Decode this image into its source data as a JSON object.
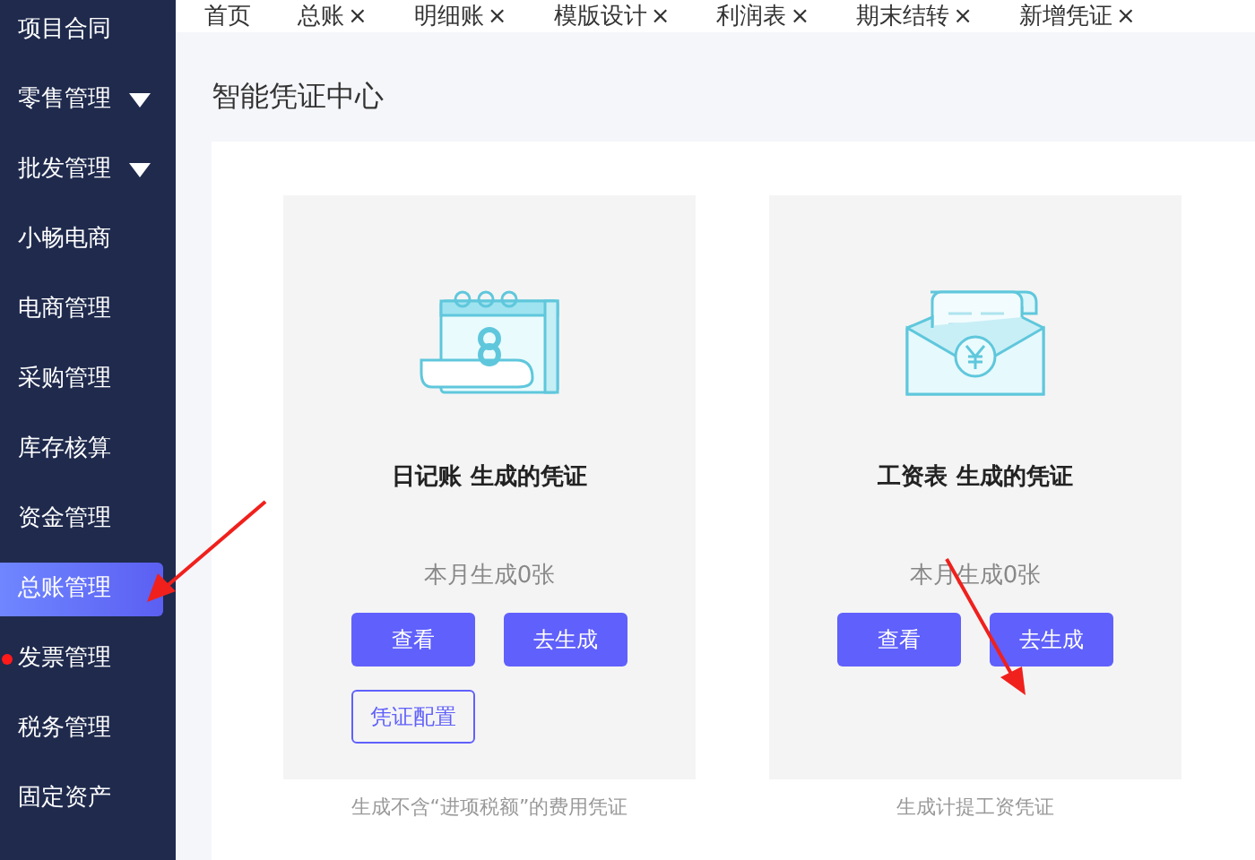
{
  "sidebar": {
    "items": [
      {
        "label": "项目合同",
        "selected": false,
        "expandable": false,
        "dot": false
      },
      {
        "label": "零售管理",
        "selected": false,
        "expandable": true,
        "dot": false
      },
      {
        "label": "批发管理",
        "selected": false,
        "expandable": true,
        "dot": false
      },
      {
        "label": "小畅电商",
        "selected": false,
        "expandable": false,
        "dot": false
      },
      {
        "label": "电商管理",
        "selected": false,
        "expandable": false,
        "dot": false
      },
      {
        "label": "采购管理",
        "selected": false,
        "expandable": false,
        "dot": false
      },
      {
        "label": "库存核算",
        "selected": false,
        "expandable": false,
        "dot": false
      },
      {
        "label": "资金管理",
        "selected": false,
        "expandable": false,
        "dot": false
      },
      {
        "label": "总账管理",
        "selected": true,
        "expandable": false,
        "dot": false
      },
      {
        "label": "发票管理",
        "selected": false,
        "expandable": false,
        "dot": true
      },
      {
        "label": "税务管理",
        "selected": false,
        "expandable": false,
        "dot": false
      },
      {
        "label": "固定资产",
        "selected": false,
        "expandable": false,
        "dot": false
      }
    ]
  },
  "tabs": [
    {
      "label": "首页",
      "closable": false,
      "selected": false
    },
    {
      "label": "总账",
      "closable": true,
      "selected": false
    },
    {
      "label": "明细账",
      "closable": true,
      "selected": false
    },
    {
      "label": "模版设计",
      "closable": true,
      "selected": false
    },
    {
      "label": "利润表",
      "closable": true,
      "selected": false
    },
    {
      "label": "期末结转",
      "closable": true,
      "selected": false
    },
    {
      "label": "新增凭证",
      "closable": true,
      "selected": false
    }
  ],
  "tab_close": "×",
  "page_title": "智能凭证中心",
  "cards": [
    {
      "kind": "calendar",
      "title": "日记账 生成的凭证",
      "count": "本月生成0张",
      "buttons": [
        {
          "label": "查看",
          "kind": "primary"
        },
        {
          "label": "去生成",
          "kind": "primary"
        },
        {
          "label": "凭证配置",
          "kind": "outline"
        }
      ],
      "description": "生成不含“进项税额”的费用凭证"
    },
    {
      "kind": "envelope",
      "title": "工资表 生成的凭证",
      "count": "本月生成0张",
      "buttons": [
        {
          "label": "查看",
          "kind": "primary"
        },
        {
          "label": "去生成",
          "kind": "primary"
        }
      ],
      "description": "生成计提工资凭证"
    }
  ]
}
